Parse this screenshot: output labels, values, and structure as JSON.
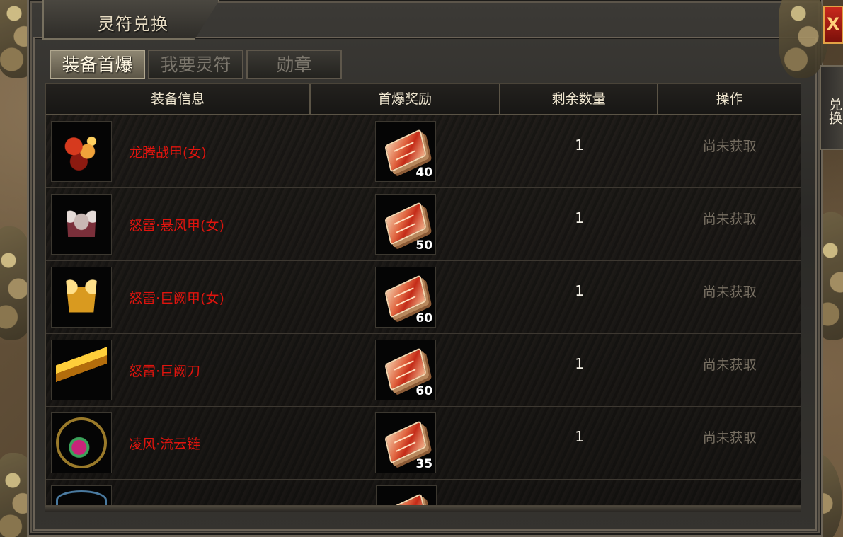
{
  "window": {
    "title": "灵符兑换",
    "close_label": "X",
    "side_tab_label": "兑换"
  },
  "tabs": [
    {
      "label": "装备首爆",
      "active": true
    },
    {
      "label": "我要灵符",
      "active": false
    },
    {
      "label": "勋章",
      "active": false
    }
  ],
  "table": {
    "headers": [
      "装备信息",
      "首爆奖励",
      "剩余数量",
      "操作"
    ],
    "rows": [
      {
        "item_name": "龙腾战甲(女)",
        "item_icon": "dragon-armor-icon",
        "reward": "40",
        "remaining": "1",
        "action": "尚未获取"
      },
      {
        "item_name": "怒雷·悬风甲(女)",
        "item_icon": "winged-armor-icon",
        "reward": "50",
        "remaining": "1",
        "action": "尚未获取"
      },
      {
        "item_name": "怒雷·巨阙甲(女)",
        "item_icon": "golden-armor-icon",
        "reward": "60",
        "remaining": "1",
        "action": "尚未获取"
      },
      {
        "item_name": "怒雷·巨阙刀",
        "item_icon": "blade-icon",
        "reward": "60",
        "remaining": "1",
        "action": "尚未获取"
      },
      {
        "item_name": "凌风·流云链",
        "item_icon": "necklace-icon",
        "reward": "35",
        "remaining": "1",
        "action": "尚未获取"
      }
    ]
  },
  "colors": {
    "item_name": "#e0140e",
    "action_disabled": "#776f62",
    "count": "#f4f0e6",
    "header_text": "#efe6cf"
  },
  "reward_icon": "talisman-bundle-icon"
}
